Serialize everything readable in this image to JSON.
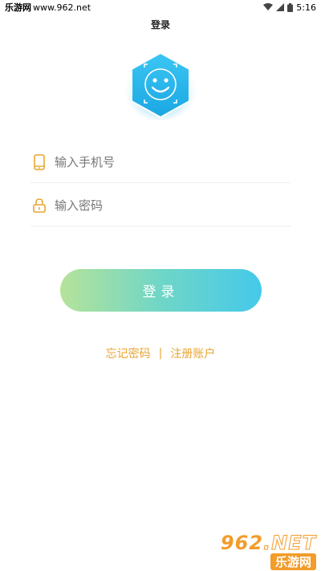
{
  "status_bar": {
    "brand": "乐游网",
    "url": "www.962.net",
    "time": "5:16",
    "icons": [
      "wifi-icon",
      "signal-icon",
      "battery-icon"
    ]
  },
  "header": {
    "title": "登录"
  },
  "logo": {
    "icon": "smiley-hexagon-icon",
    "accent": "#2bb6ea"
  },
  "form": {
    "phone": {
      "placeholder": "输入手机号",
      "value": "",
      "icon": "phone-icon"
    },
    "password": {
      "placeholder": "输入密码",
      "value": "",
      "icon": "lock-icon"
    }
  },
  "login_button": {
    "label": "登录"
  },
  "links": {
    "forgot_password": "忘记密码",
    "separator": "|",
    "register": "注册账户"
  },
  "watermark": {
    "site": "962",
    "suffix": ".NET",
    "name": "乐游网"
  },
  "colors": {
    "accent_orange": "#e9a531",
    "button_start": "#b6e39a",
    "button_end": "#45c9ea",
    "logo_blue": "#2bb6ea"
  }
}
